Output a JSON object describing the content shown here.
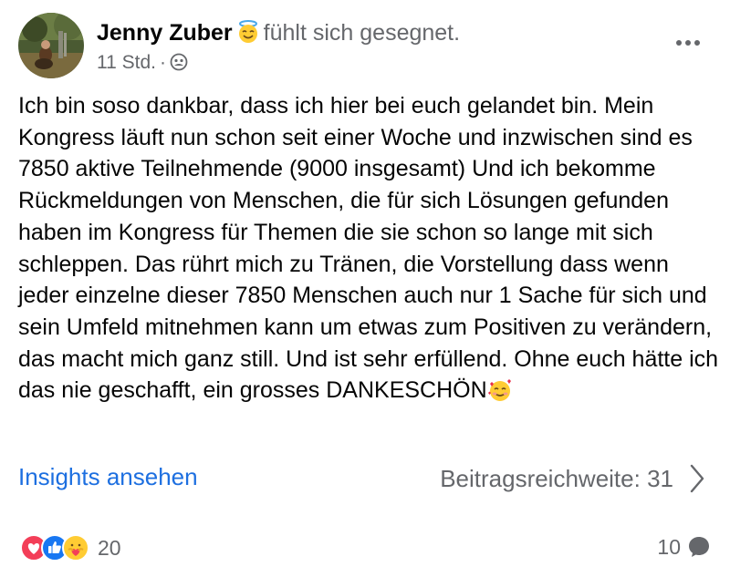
{
  "post": {
    "author": "Jenny Zuber",
    "feeling_icon": "smiling-face-with-halo-emoji",
    "feeling": "fühlt sich gesegnet.",
    "time": "11 Std.",
    "separator": "·",
    "audience_icon": "friends-audience-icon",
    "text": "Ich bin soso dankbar, dass ich hier bei euch gelandet bin. Mein Kongress läuft nun schon seit einer Woche und inzwischen sind es 7850 aktive Teilnehmende (9000 insgesamt) Und ich bekomme Rückmeldungen von Menschen, die für sich Lösungen gefunden haben im Kongress für Themen die sie schon so lange mit sich schleppen. Das rührt mich zu Tränen, die Vorstellung dass wenn jeder einzelne dieser 7850 Menschen auch nur 1 Sache für sich und sein Umfeld mitnehmen kann um etwas zum Positiven zu verändern, das macht mich ganz still. Und ist sehr erfüllend. Ohne euch hätte ich das nie geschafft, ein grosses DANKESCHÖN",
    "text_end_emoji": "smiling-face-with-hearts-emoji"
  },
  "insights": {
    "link_label": "Insights ansehen",
    "reach_label": "Beitragsreichweite: 31"
  },
  "footer": {
    "reactions": [
      "love-reaction-icon",
      "like-reaction-icon",
      "care-reaction-icon"
    ],
    "reaction_count": "20",
    "comment_count": "10",
    "comment_icon": "comment-bubble-icon"
  },
  "colors": {
    "link": "#1d6fe0",
    "secondary_text": "#65676b",
    "love": "#f33e58",
    "like": "#1877f2"
  }
}
